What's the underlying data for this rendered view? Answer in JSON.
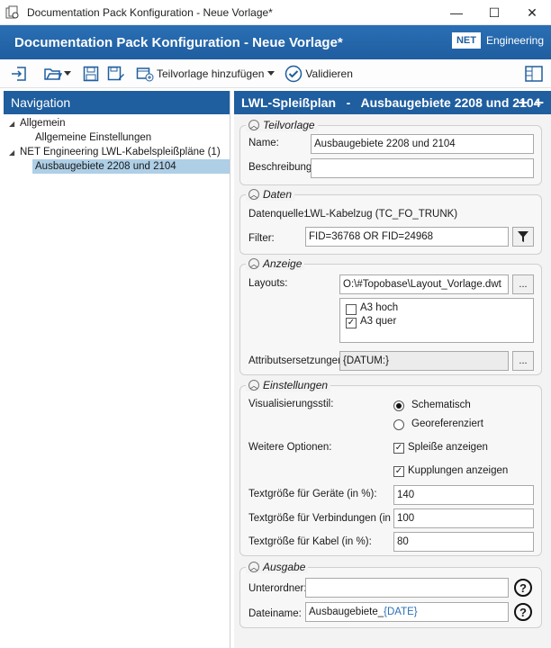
{
  "window": {
    "title": "Documentation Pack Konfiguration - Neue Vorlage*",
    "minimize": "—",
    "maximize": "☐",
    "close": "✕"
  },
  "banner": {
    "title": "Documentation Pack Konfiguration - Neue Vorlage*",
    "logo_net": "NET",
    "logo_eng": "Engineering"
  },
  "toolbar": {
    "add_template_label": "Teilvorlage hinzufügen",
    "validate_label": "Validieren"
  },
  "navigation": {
    "header": "Navigation",
    "items": [
      {
        "label": "Allgemein"
      },
      {
        "label": "Allgemeine Einstellungen"
      },
      {
        "label": "NET Engineering LWL-Kabelspleißpläne (1)"
      },
      {
        "label": "Ausbaugebiete 2208 und 2104"
      }
    ]
  },
  "main": {
    "header": "LWL-Spleißplan   -   Ausbaugebiete 2208 und 2104",
    "teilvorlage": {
      "legend": "Teilvorlage",
      "name_label": "Name:",
      "name_value": "Ausbaugebiete 2208 und 2104",
      "desc_label": "Beschreibung:",
      "desc_value": ""
    },
    "daten": {
      "legend": "Daten",
      "source_label": "Datenquelle:",
      "source_value": "LWL-Kabelzug (TC_FO_TRUNK)",
      "filter_label": "Filter:",
      "filter_value": "FID=36768 OR FID=24968"
    },
    "anzeige": {
      "legend": "Anzeige",
      "layouts_label": "Layouts:",
      "layouts_value": "O:\\#Topobase\\Layout_Vorlage.dwt",
      "browse": "...",
      "options": [
        {
          "label": "A3 hoch",
          "checked": false
        },
        {
          "label": "A3 quer",
          "checked": true
        }
      ],
      "attr_label": "Attributsersetzungen:",
      "attr_value": "{DATUM:}"
    },
    "einstellungen": {
      "legend": "Einstellungen",
      "vis_label": "Visualisierungsstil:",
      "vis_opt1": "Schematisch",
      "vis_opt2": "Georeferenziert",
      "vis_selected": "Schematisch",
      "more_label": "Weitere Optionen:",
      "opt_splices": "Spleiße anzeigen",
      "opt_couplings": "Kupplungen anzeigen",
      "size_devices_label": "Textgröße für Geräte (in %):",
      "size_devices_value": "140",
      "size_conn_label": "Textgröße für Verbindungen (in %):",
      "size_conn_value": "100",
      "size_cable_label": "Textgröße für Kabel (in %):",
      "size_cable_value": "80"
    },
    "ausgabe": {
      "legend": "Ausgabe",
      "subfolder_label": "Unterordner:",
      "subfolder_value": "",
      "filename_label": "Dateiname:",
      "filename_prefix": "Ausbaugebiete_",
      "filename_token": "{DATE}",
      "help": "?"
    }
  }
}
